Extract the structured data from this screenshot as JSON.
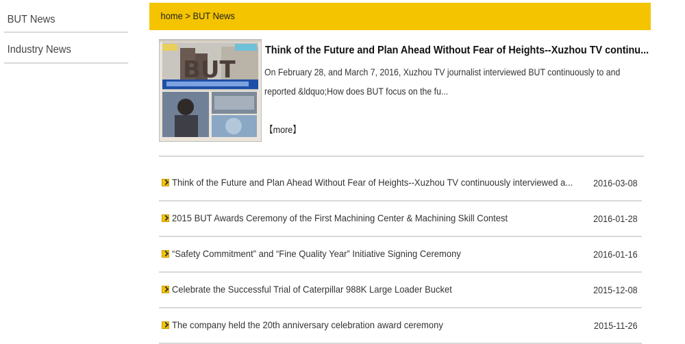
{
  "sidebar": {
    "items": [
      {
        "label": "BUT News"
      },
      {
        "label": "Industry News"
      }
    ]
  },
  "breadcrumb": {
    "home": "home",
    "separator": " > ",
    "current": "BUT News"
  },
  "feature": {
    "title": "Think of the Future and Plan Ahead Without Fear of Heights--Xuzhou TV continu...",
    "description": "On February 28, and March 7, 2016, Xuzhou TV journalist interviewed BUT continuously to and reported &ldquo;How does BUT focus on the fu...",
    "more_label": "【more】",
    "thumbnail_caption": "BUT"
  },
  "news": [
    {
      "title": "Think of the Future and Plan Ahead Without Fear of Heights--Xuzhou TV continuously interviewed a...",
      "date": "2016-03-08"
    },
    {
      "title": "2015 BUT Awards Ceremony of the First Machining Center & Machining Skill Contest",
      "date": "2016-01-28"
    },
    {
      "title": "“Safety Commitment” and “Fine Quality Year” Initiative Signing Ceremony",
      "date": "2016-01-16"
    },
    {
      "title": "Celebrate the Successful Trial of Caterpillar 988K Large Loader Bucket",
      "date": "2015-12-08"
    },
    {
      "title": "The company held the 20th anniversary celebration award ceremony",
      "date": "2015-11-26"
    }
  ],
  "colors": {
    "accent": "#f5c400",
    "divider": "#d9d9d9"
  }
}
